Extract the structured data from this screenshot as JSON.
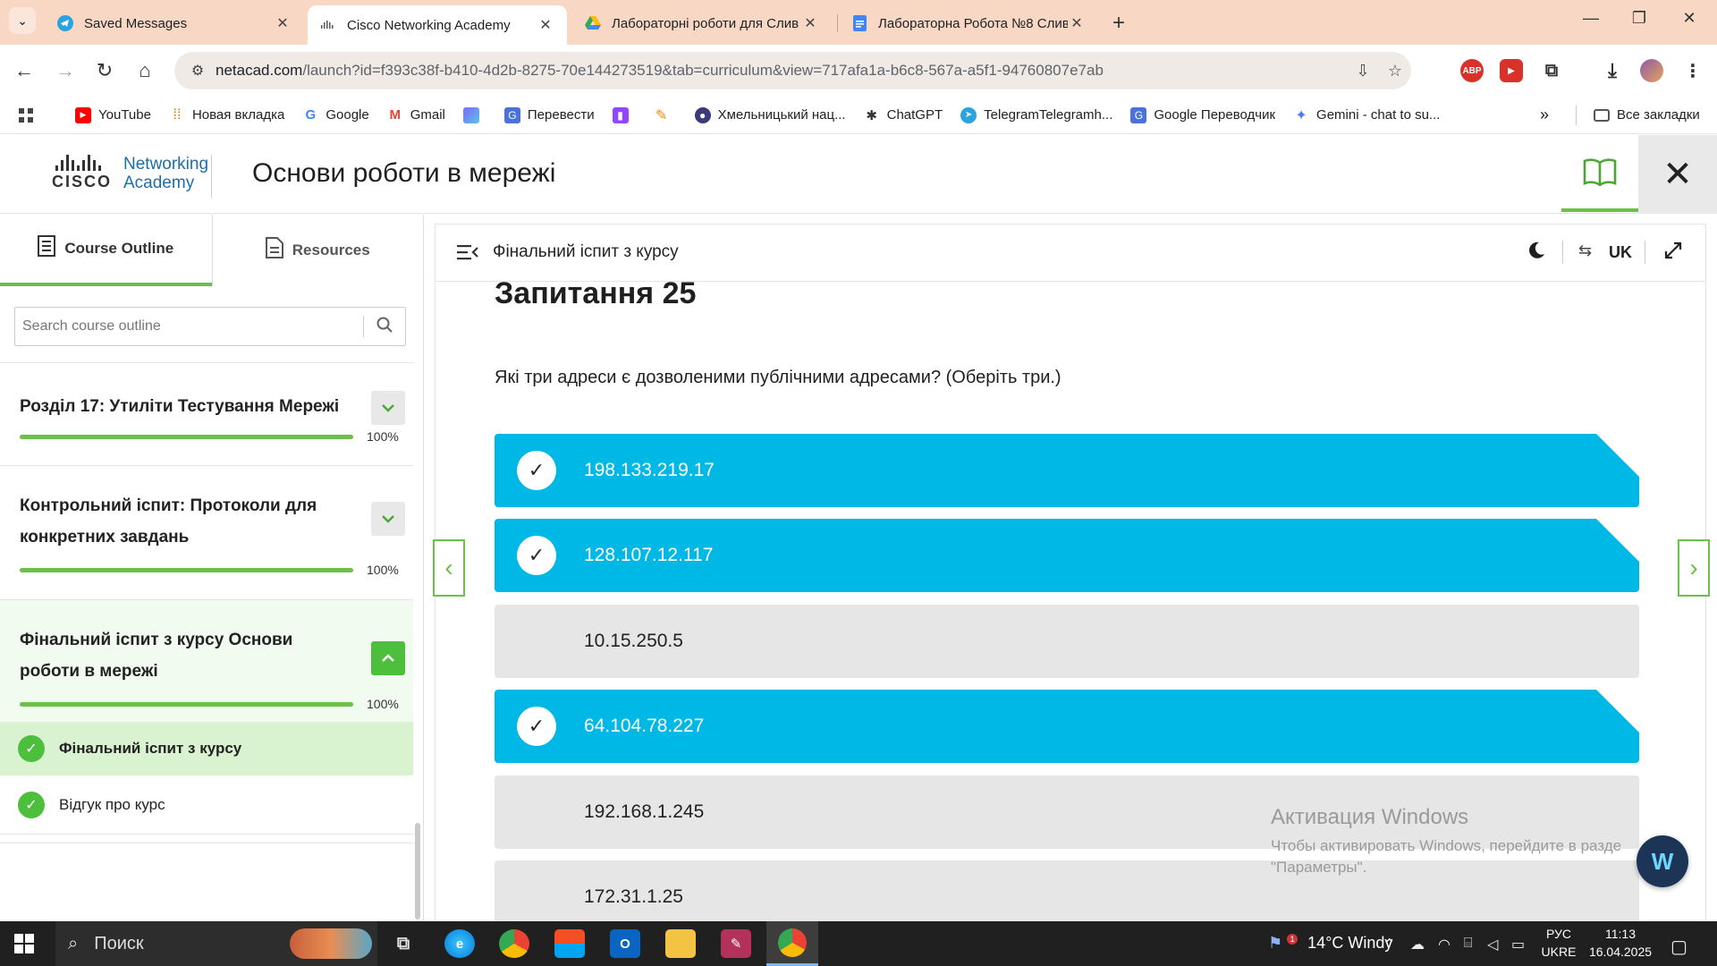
{
  "browser": {
    "tabs": [
      {
        "label": "Saved Messages",
        "icon": "telegram-icon",
        "active": false
      },
      {
        "label": "Cisco Networking Academy",
        "icon": "cisco-icon",
        "active": true
      },
      {
        "label": "Лабораторні роботи для Слив",
        "icon": "google-drive-icon",
        "active": false
      },
      {
        "label": "Лабораторна Робота №8 Слив",
        "icon": "google-docs-icon",
        "active": false
      }
    ],
    "url_host": "netacad.com",
    "url_path": "/launch?id=f393c38f-b410-4d2b-8275-70e144273519&tab=curriculum&view=717afa1a-b6c8-567a-a5f1-94760807e7ab",
    "bookmarks": [
      {
        "label": "YouTube",
        "icon": "youtube-icon"
      },
      {
        "label": "Новая вкладка",
        "icon": "apps-grid-icon"
      },
      {
        "label": "Google",
        "icon": "google-icon"
      },
      {
        "label": "Gmail",
        "icon": "gmail-icon"
      },
      {
        "label": "",
        "icon": "ai-icon"
      },
      {
        "label": "Перевести",
        "icon": "translate-icon"
      },
      {
        "label": "",
        "icon": "twitch-icon"
      },
      {
        "label": "",
        "icon": "bookmark-icon"
      },
      {
        "label": "Хмельницький нац...",
        "icon": "university-icon"
      },
      {
        "label": "ChatGPT",
        "icon": "chatgpt-icon"
      },
      {
        "label": "TelegramTelegramh...",
        "icon": "telegram-icon"
      },
      {
        "label": "Google Переводчик",
        "icon": "translate-icon"
      },
      {
        "label": "Gemini - chat to su...",
        "icon": "gemini-icon"
      }
    ],
    "all_bookmarks": "Все закладки",
    "ext_abp": "ABP"
  },
  "header": {
    "logo_word": "CISCO",
    "logo_line1": "Networking",
    "logo_line2": "Academy",
    "course_title": "Основи роботи в мережі"
  },
  "sidebar": {
    "tab_outline": "Course Outline",
    "tab_resources": "Resources",
    "search_placeholder": "Search course outline",
    "sections": [
      {
        "title": "Розділ 17: Утиліти Тестування Мережі",
        "progress": "100%",
        "expanded": false
      },
      {
        "title": "Контрольний іспит: Протоколи для конкретних завдань",
        "progress": "100%",
        "expanded": false
      },
      {
        "title": "Фінальний іспит з курсу Основи роботи в мережі",
        "progress": "100%",
        "expanded": true
      }
    ],
    "lessons": [
      {
        "title": "Фінальний іспит з курсу",
        "active": true
      },
      {
        "title": "Відгук про курс",
        "active": false
      }
    ]
  },
  "main": {
    "header_title": "Фінальний іспит з курсу",
    "language": "UK",
    "question_title": "Запитання 25",
    "question_text": "Які три адреси є дозволеними публічними адресами? (Оберіть три.)",
    "answers": [
      {
        "text": "198.133.219.17",
        "selected": true
      },
      {
        "text": "128.107.12.117",
        "selected": true
      },
      {
        "text": "10.15.250.5",
        "selected": false
      },
      {
        "text": "64.104.78.227",
        "selected": true
      },
      {
        "text": "192.168.1.245",
        "selected": false
      },
      {
        "text": "172.31.1.25",
        "selected": false
      }
    ]
  },
  "watermark": {
    "line1": "Активация Windows",
    "line2": "Чтобы активировать Windows, перейдите в разде",
    "line3": "\"Параметры\"."
  },
  "taskbar": {
    "search_label": "Поиск",
    "weather": "14°C  Windy",
    "lang_line1": "РУС",
    "lang_line2": "UKRE",
    "time": "11:13",
    "date": "16.04.2025",
    "notification_count": "1"
  },
  "colors": {
    "accent_green": "#6cc04a",
    "selected_answer": "#00b8e6",
    "tab_strip": "#f8d8c4"
  }
}
